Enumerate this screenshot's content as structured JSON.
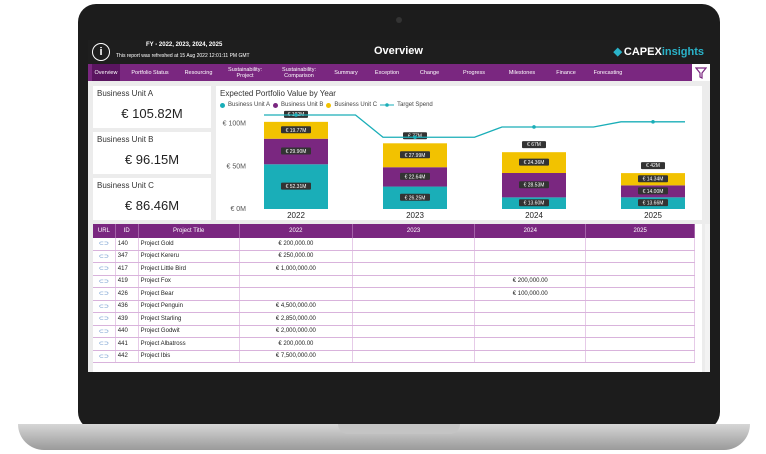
{
  "header": {
    "fy": "FY - 2022, 2023, 2024, 2025",
    "refresh_note": "This report was refreshed at 15 Aug 2022 12:01:11 PM GMT",
    "title": "Overview",
    "logo_part1": "CAPEX",
    "logo_part2": "insights"
  },
  "nav": [
    {
      "label": "Overview",
      "active": true
    },
    {
      "label": "Portfolio Status"
    },
    {
      "label": "Resourcing"
    },
    {
      "label": "Sustainability: Project"
    },
    {
      "label": "Sustainability: Comparison"
    },
    {
      "label": "Summary"
    },
    {
      "label": "Exception"
    },
    {
      "label": "Change"
    },
    {
      "label": "Progress"
    },
    {
      "label": "Milestones"
    },
    {
      "label": "Finance"
    },
    {
      "label": "Forecasting"
    }
  ],
  "kpis": [
    {
      "label": "Business Unit A",
      "value": "€ 105.82M"
    },
    {
      "label": "Business Unit B",
      "value": "€ 96.15M"
    },
    {
      "label": "Business Unit C",
      "value": "€ 86.46M"
    }
  ],
  "colors": {
    "unit_a": "#1aaeb8",
    "unit_b": "#7a2780",
    "unit_c": "#f2c200",
    "target": "#1aaeb8",
    "brand": "#7a2780"
  },
  "chart_data": {
    "type": "bar",
    "title": "Expected Portfolio Value by Year",
    "categories": [
      "2022",
      "2023",
      "2024",
      "2025"
    ],
    "ylim": [
      0,
      110
    ],
    "y_ticks": [
      "€ 0M",
      "€ 50M",
      "€ 100M"
    ],
    "series": [
      {
        "name": "Business Unit A",
        "values": [
          52.31,
          26.25,
          13.6,
          13.66
        ],
        "labels": [
          "€ 52.31M",
          "€ 26.25M",
          "€ 13.60M",
          "€ 13.66M"
        ]
      },
      {
        "name": "Business Unit B",
        "values": [
          29.9,
          22.64,
          28.53,
          14.0
        ],
        "labels": [
          "€ 29.90M",
          "€ 22.64M",
          "€ 28.53M",
          "€ 14.00M"
        ]
      },
      {
        "name": "Business Unit C",
        "values": [
          19.77,
          27.99,
          24.36,
          14.34
        ],
        "labels": [
          "€ 19.77M",
          "€ 27.99M",
          "€ 24.36M",
          "€ 14.34M"
        ]
      }
    ],
    "totals": [
      "€ 102M",
      "€ 77M",
      "€ 67M",
      "€ 42M"
    ],
    "target": {
      "name": "Target Spend",
      "values": [
        110,
        84,
        96,
        102
      ]
    }
  },
  "table": {
    "columns": [
      "URL",
      "ID",
      "Project Title",
      "2022",
      "2023",
      "2024",
      "2025"
    ],
    "rows": [
      [
        "140",
        "Project Gold",
        "€ 200,000.00",
        "",
        "",
        ""
      ],
      [
        "347",
        "Project Kereru",
        "€ 250,000.00",
        "",
        "",
        ""
      ],
      [
        "417",
        "Project Little Bird",
        "€ 1,000,000.00",
        "",
        "",
        ""
      ],
      [
        "419",
        "Project Fox",
        "",
        "",
        "€ 200,000.00",
        ""
      ],
      [
        "426",
        "Project Bear",
        "",
        "",
        "€ 100,000.00",
        ""
      ],
      [
        "436",
        "Project Penguin",
        "€ 4,500,000.00",
        "",
        "",
        ""
      ],
      [
        "439",
        "Project Starling",
        "€ 2,850,000.00",
        "",
        "",
        ""
      ],
      [
        "440",
        "Project Godwit",
        "€ 2,000,000.00",
        "",
        "",
        ""
      ],
      [
        "441",
        "Project Albatross",
        "€ 200,000.00",
        "",
        "",
        ""
      ],
      [
        "442",
        "Project Ibis",
        "€ 7,500,000.00",
        "",
        "",
        ""
      ]
    ]
  }
}
